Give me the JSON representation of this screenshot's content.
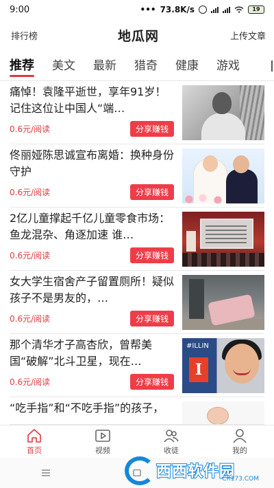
{
  "status_bar": {
    "time": "9:00",
    "speed": "73.8K/s",
    "battery": "19"
  },
  "header": {
    "left": "排行榜",
    "title": "地瓜网",
    "right": "上传文章"
  },
  "tabs": [
    {
      "label": "推荐",
      "active": true
    },
    {
      "label": "美文",
      "active": false
    },
    {
      "label": "最新",
      "active": false
    },
    {
      "label": "猎奇",
      "active": false
    },
    {
      "label": "健康",
      "active": false
    },
    {
      "label": "游戏",
      "active": false
    }
  ],
  "articles": [
    {
      "title": "痛悼！袁隆平逝世，享年91岁！记住这位让中国人“端…",
      "price": "0.6元/阅读",
      "button": "分享赚钱"
    },
    {
      "title": "佟丽娅陈思诚宣布离婚：换种身份守护",
      "price": "0.6元/阅读",
      "button": "分享赚钱"
    },
    {
      "title": "2亿儿童撑起千亿儿童零食市场：鱼龙混杂、角逐加速 谁…",
      "price": "0.6元/阅读",
      "button": "分享赚钱"
    },
    {
      "title": "女大学生宿舍产子留置厕所！疑似孩子不是男友的，…",
      "price": "0.6元/阅读",
      "button": "分享赚钱"
    },
    {
      "title": "那个清华才子高杏欣，曾帮美国“破解”北斗卫星，现在…",
      "price": "0.6元/阅读",
      "button": "分享赚钱"
    },
    {
      "title": "“吃手指”和“不吃手指”的孩子，长大后差距很大，家长…",
      "price": "",
      "button": ""
    }
  ],
  "thumb5_banner": "#ILLIN",
  "thumb5_logo": "I",
  "bottom_nav": [
    {
      "label": "首页",
      "icon": "home-icon",
      "active": true
    },
    {
      "label": "视频",
      "icon": "video-icon",
      "active": false
    },
    {
      "label": "收徒",
      "icon": "recruit-icon",
      "active": false
    },
    {
      "label": "我的",
      "icon": "profile-icon",
      "active": false
    }
  ],
  "watermark": {
    "text": "西西软件园",
    "url": "CR173.COM"
  },
  "colors": {
    "accent": "#e0383f",
    "button": "#ef3d48",
    "watermark": "#1687d9"
  }
}
